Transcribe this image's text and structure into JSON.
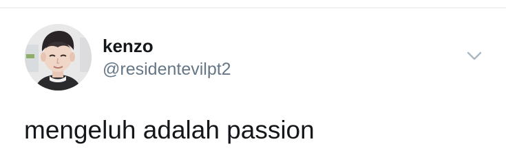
{
  "tweet": {
    "author": {
      "display_name": "kenzo",
      "handle": "@residentevilpt2",
      "avatar_icon": "profile-photo"
    },
    "text": "mengeluh adalah passion",
    "menu_icon": "chevron-down-icon"
  },
  "colors": {
    "name_text": "#14171a",
    "handle_text": "#657786",
    "divider": "#e3e4e6",
    "caret": "#aab8c2"
  }
}
